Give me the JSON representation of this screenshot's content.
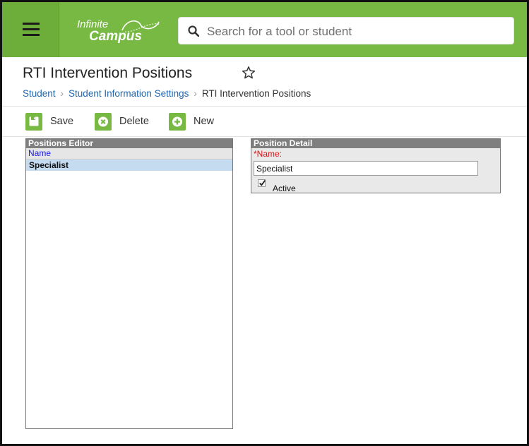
{
  "header": {
    "logo_line1": "Infinite",
    "logo_line2": "Campus",
    "search_placeholder": "Search for a tool or student",
    "brand_color": "#77b943"
  },
  "page": {
    "title": "RTI Intervention Positions",
    "breadcrumb": [
      "Student",
      "Student Information Settings",
      "RTI Intervention Positions"
    ]
  },
  "toolbar": {
    "save_label": "Save",
    "delete_label": "Delete",
    "new_label": "New"
  },
  "editor": {
    "title": "Positions Editor",
    "column_header": "Name",
    "rows": [
      "Specialist"
    ]
  },
  "detail": {
    "title": "Position Detail",
    "name_label": "*Name:",
    "name_value": "Specialist",
    "active_label": "Active",
    "active_checked": true
  },
  "icons": {
    "menu": "hamburger-icon",
    "search": "search-icon",
    "favorite": "star-outline-icon",
    "save": "floppy-disk-icon",
    "delete": "x-circle-icon",
    "new": "plus-circle-icon"
  }
}
